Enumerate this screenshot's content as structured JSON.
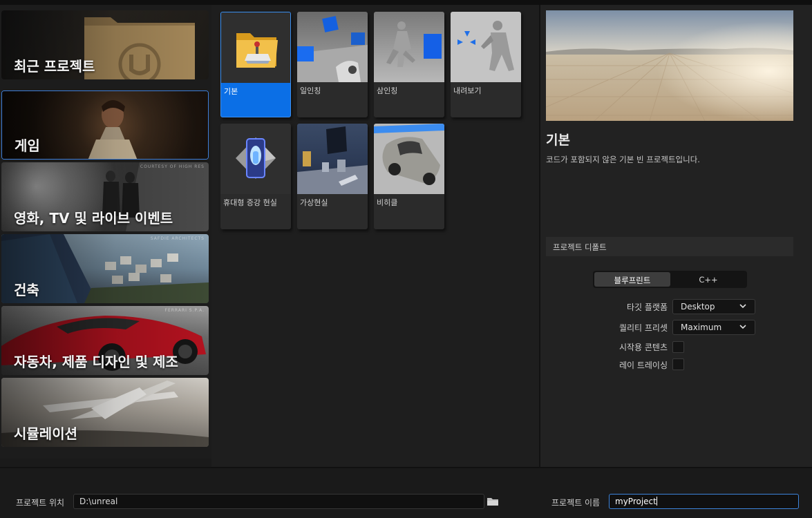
{
  "categories": [
    {
      "label": "최근 프로젝트",
      "credit": ""
    },
    {
      "label": "게임",
      "credit": ""
    },
    {
      "label": "영화, TV 및 라이브 이벤트",
      "credit": "COURTESY OF HIGH RES"
    },
    {
      "label": "건축",
      "credit": "SAFDIE ARCHITECTS"
    },
    {
      "label": "자동차, 제품 디자인 및 제조",
      "credit": "FERRARI S.P.A."
    },
    {
      "label": "시뮬레이션",
      "credit": ""
    }
  ],
  "selected_category": "게임",
  "templates": [
    {
      "label": "기본",
      "icon": "folder-controller-icon"
    },
    {
      "label": "일인칭",
      "icon": "first-person-scene"
    },
    {
      "label": "삼인칭",
      "icon": "third-person-scene"
    },
    {
      "label": "내려보기",
      "icon": "top-down-scene"
    },
    {
      "label": "휴대형 증강 현실",
      "icon": "handheld-ar-icon"
    },
    {
      "label": "가상현실",
      "icon": "virtual-reality-scene"
    },
    {
      "label": "비히클",
      "icon": "vehicle-scene"
    }
  ],
  "selected_template": "기본",
  "details": {
    "title": "기본",
    "description": "코드가 포함되지 않은 기본 빈 프로젝트입니다.",
    "defaults_header": "프로젝트 디폴트",
    "language": {
      "options": [
        "블루프린트",
        "C++"
      ],
      "selected": "블루프린트"
    },
    "target_platform_label": "타깃 플랫폼",
    "target_platform_value": "Desktop",
    "quality_preset_label": "퀄리티 프리셋",
    "quality_preset_value": "Maximum",
    "starter_content_label": "시작용 콘텐츠",
    "starter_content_checked": false,
    "raytracing_label": "레이 트레이싱",
    "raytracing_checked": false
  },
  "bottom": {
    "location_label": "프로젝트 위치",
    "location_value": "D:\\unreal",
    "name_label": "프로젝트 이름",
    "name_value": "myProject"
  },
  "colors": {
    "accent": "#0b6fe6",
    "selection_border": "#3f7fd8"
  }
}
